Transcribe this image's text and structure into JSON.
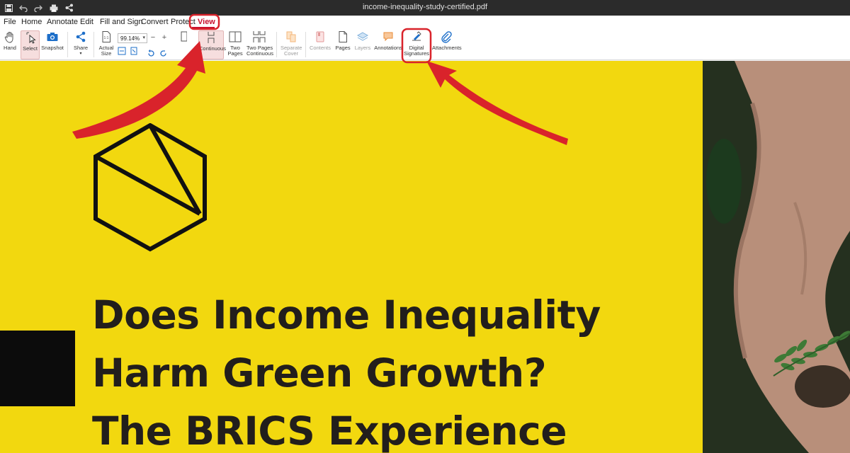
{
  "window": {
    "title": "income-inequality-study-certified.pdf"
  },
  "quick_access": [
    "save-icon",
    "undo-icon",
    "redo-icon",
    "print-icon",
    "share-icon"
  ],
  "menu": {
    "items": [
      {
        "label": "File"
      },
      {
        "label": "Home"
      },
      {
        "label": "Annotate"
      },
      {
        "label": "Edit"
      },
      {
        "label": "Fill and Sign"
      },
      {
        "label": "Convert"
      },
      {
        "label": "Protect"
      },
      {
        "label": "View"
      }
    ],
    "active": "View"
  },
  "ribbon": {
    "hand": "Hand",
    "select": "Select",
    "snapshot": "Snapshot",
    "share": "Share",
    "actual_size_1": "Actual",
    "actual_size_2": "Size",
    "zoom_value": "99.14%",
    "zoom_minus": "−",
    "zoom_plus": "+",
    "continuous": "Continuous",
    "two_pages_1": "Two",
    "two_pages_2": "Pages",
    "two_pages_cont_1": "Two Pages",
    "two_pages_cont_2": "Continuous",
    "separate_cover_1": "Separate",
    "separate_cover_2": "Cover",
    "contents": "Contents",
    "pages": "Pages",
    "layers": "Layers",
    "annotations": "Annotations",
    "digital_sig_1": "Digital",
    "digital_sig_2": "Signatures",
    "attachments": "Attachments"
  },
  "document": {
    "title_lines": [
      "Does Income Inequality",
      "Harm Green Growth?",
      "The BRICS Experience"
    ]
  },
  "colors": {
    "accent": "#c8102e",
    "page_yellow": "#f2d80f",
    "title_text": "#221e1c",
    "annotation_red": "#d9232b"
  }
}
